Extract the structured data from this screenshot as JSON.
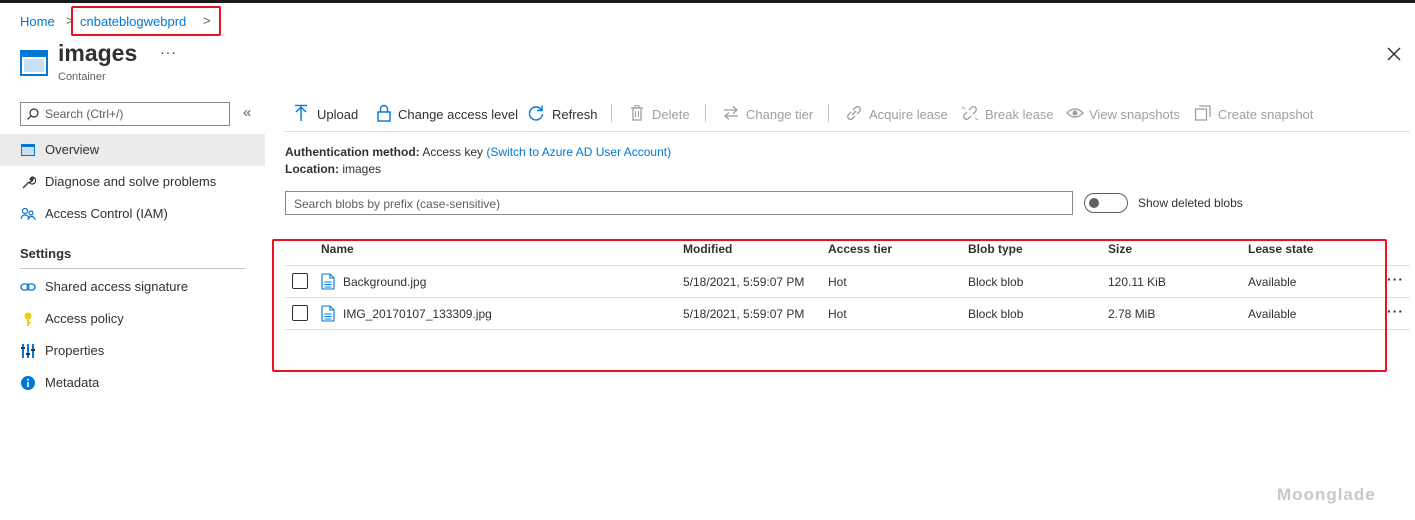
{
  "breadcrumb": {
    "home": "Home",
    "account": "cnbateblogwebprd",
    "separator": ">"
  },
  "header": {
    "title": "images",
    "subtitle": "Container",
    "more": "···",
    "close": "✕"
  },
  "sidebar": {
    "search_placeholder": "Search (Ctrl+/)",
    "collapse": "«",
    "items": [
      {
        "label": "Overview",
        "icon": "container-icon",
        "active": true
      },
      {
        "label": "Diagnose and solve problems",
        "icon": "wrench-icon"
      },
      {
        "label": "Access Control (IAM)",
        "icon": "people-icon"
      }
    ],
    "settings_heading": "Settings",
    "settings_items": [
      {
        "label": "Shared access signature",
        "icon": "link-icon"
      },
      {
        "label": "Access policy",
        "icon": "key-icon"
      },
      {
        "label": "Properties",
        "icon": "properties-icon"
      },
      {
        "label": "Metadata",
        "icon": "info-icon"
      }
    ]
  },
  "toolbar": {
    "upload": "Upload",
    "change_access_level": "Change access level",
    "refresh": "Refresh",
    "delete": "Delete",
    "change_tier": "Change tier",
    "acquire_lease": "Acquire lease",
    "break_lease": "Break lease",
    "view_snapshots": "View snapshots",
    "create_snapshot": "Create snapshot"
  },
  "info": {
    "auth_label": "Authentication method:",
    "auth_value": "Access key",
    "auth_link": "(Switch to Azure AD User Account)",
    "location_label": "Location:",
    "location_value": "images"
  },
  "filter": {
    "placeholder": "Search blobs by prefix (case-sensitive)",
    "toggle_label": "Show deleted blobs",
    "toggle_on": false
  },
  "table": {
    "columns": [
      "Name",
      "Modified",
      "Access tier",
      "Blob type",
      "Size",
      "Lease state"
    ],
    "rows": [
      {
        "name": "Background.jpg",
        "modified": "5/18/2021, 5:59:07 PM",
        "tier": "Hot",
        "type": "Block blob",
        "size": "120.11 KiB",
        "lease": "Available",
        "more": "···"
      },
      {
        "name": "IMG_20170107_133309.jpg",
        "modified": "5/18/2021, 5:59:07 PM",
        "tier": "Hot",
        "type": "Block blob",
        "size": "2.78 MiB",
        "lease": "Available",
        "more": "···"
      }
    ]
  },
  "watermark": "Moonglade",
  "colors": {
    "accent": "#0078d4",
    "highlight": "#e81123",
    "disabled": "#a19f9d"
  }
}
